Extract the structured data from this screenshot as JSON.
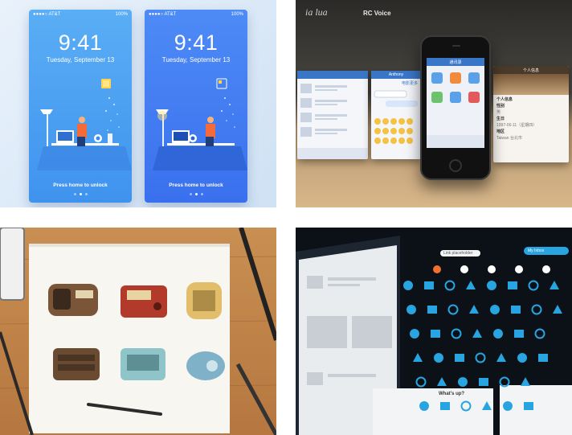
{
  "tile1": {
    "phones": [
      {
        "carrier": "●●●●○ AT&T",
        "battery": "100%",
        "time": "9:41",
        "date": "Tuesday, September 13",
        "unlock": "Press home to unlock",
        "bg": "#4aa0f3"
      },
      {
        "carrier": "●●●●○ AT&T",
        "battery": "100%",
        "time": "9:41",
        "date": "Tuesday, September 13",
        "unlock": "Press home to unlock",
        "bg": "#3d7ef5"
      }
    ]
  },
  "tile2": {
    "brand": "ia lua",
    "brand2": "RC Voice",
    "left_card_title": "Anthony",
    "left_card_button": "电影更多",
    "center_title": "通讯录",
    "right_card_title": "个人信息",
    "right_rows": [
      "个人信息",
      "性别",
      "男",
      "生日",
      "1997-06-11（星期四）",
      "地区",
      "Taiwan 台北市"
    ]
  },
  "tile4": {
    "top_pill": "Link placeholder",
    "top_pill2": "My Inbox",
    "whats_up": "What's up?",
    "accent": "#28a4e0"
  }
}
